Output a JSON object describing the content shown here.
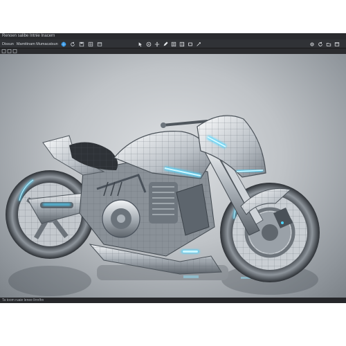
{
  "window": {
    "title": "Renoen salibe Intnie Inacern"
  },
  "toolbar": {
    "menu": [
      {
        "label": "Dissun"
      },
      {
        "label": "Mamitinam Mumacatsun"
      }
    ],
    "center_icons": [
      "select-icon",
      "rotate-icon",
      "move-icon",
      "pen-icon",
      "grid-icon",
      "layers-icon",
      "render-icon",
      "camera-icon"
    ],
    "right_icons": [
      "settings-icon",
      "refresh-icon",
      "folder-icon",
      "window-icon"
    ]
  },
  "statusbar": {
    "text": "Ta toom ruaie lenee llrnrlhn"
  },
  "colors": {
    "accent": "#2aa8ff",
    "glow": "#4fd6ff",
    "chrome": "#3a3d42"
  }
}
